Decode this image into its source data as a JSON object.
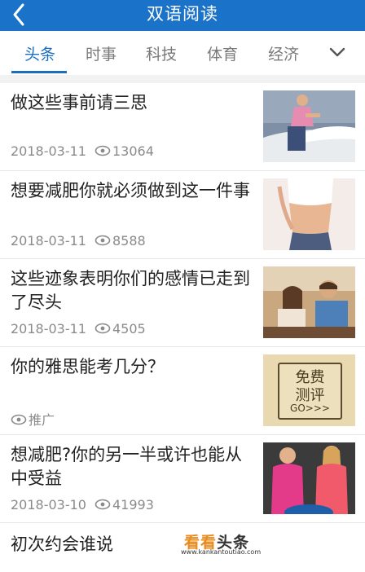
{
  "header": {
    "title": "双语阅读"
  },
  "tabs": [
    {
      "label": "头条"
    },
    {
      "label": "时事"
    },
    {
      "label": "科技"
    },
    {
      "label": "体育"
    },
    {
      "label": "经济"
    }
  ],
  "articles": [
    {
      "title": "做这些事前请三思",
      "date": "2018-03-11",
      "views": "13064",
      "thumb": "woman-making-bed"
    },
    {
      "title": "想要减肥你就必须做到这一件事",
      "date": "2018-03-11",
      "views": "8588",
      "thumb": "woman-waist"
    },
    {
      "title": "这些迹象表明你们的感情已走到了尽头",
      "date": "2018-03-11",
      "views": "4505",
      "thumb": "couple-at-table"
    },
    {
      "title": "你的雅思能考几分？",
      "tag": "推广",
      "thumb": "free-test-ad",
      "ad_lines": [
        "免费",
        "测评",
        "GO>>>"
      ]
    },
    {
      "title": "想减肥?你的另一半或许也能从中受益",
      "date": "2018-03-10",
      "views": "41993",
      "thumb": "two-women"
    },
    {
      "title": "初次约会谁说"
    }
  ],
  "watermark": {
    "brand_a": "看看",
    "brand_b": "头条",
    "url": "www.kankantoutiao.com"
  },
  "colors": {
    "header": "#1a73c9",
    "accent": "#1b6ec2",
    "watermark": "#e98a1c"
  }
}
